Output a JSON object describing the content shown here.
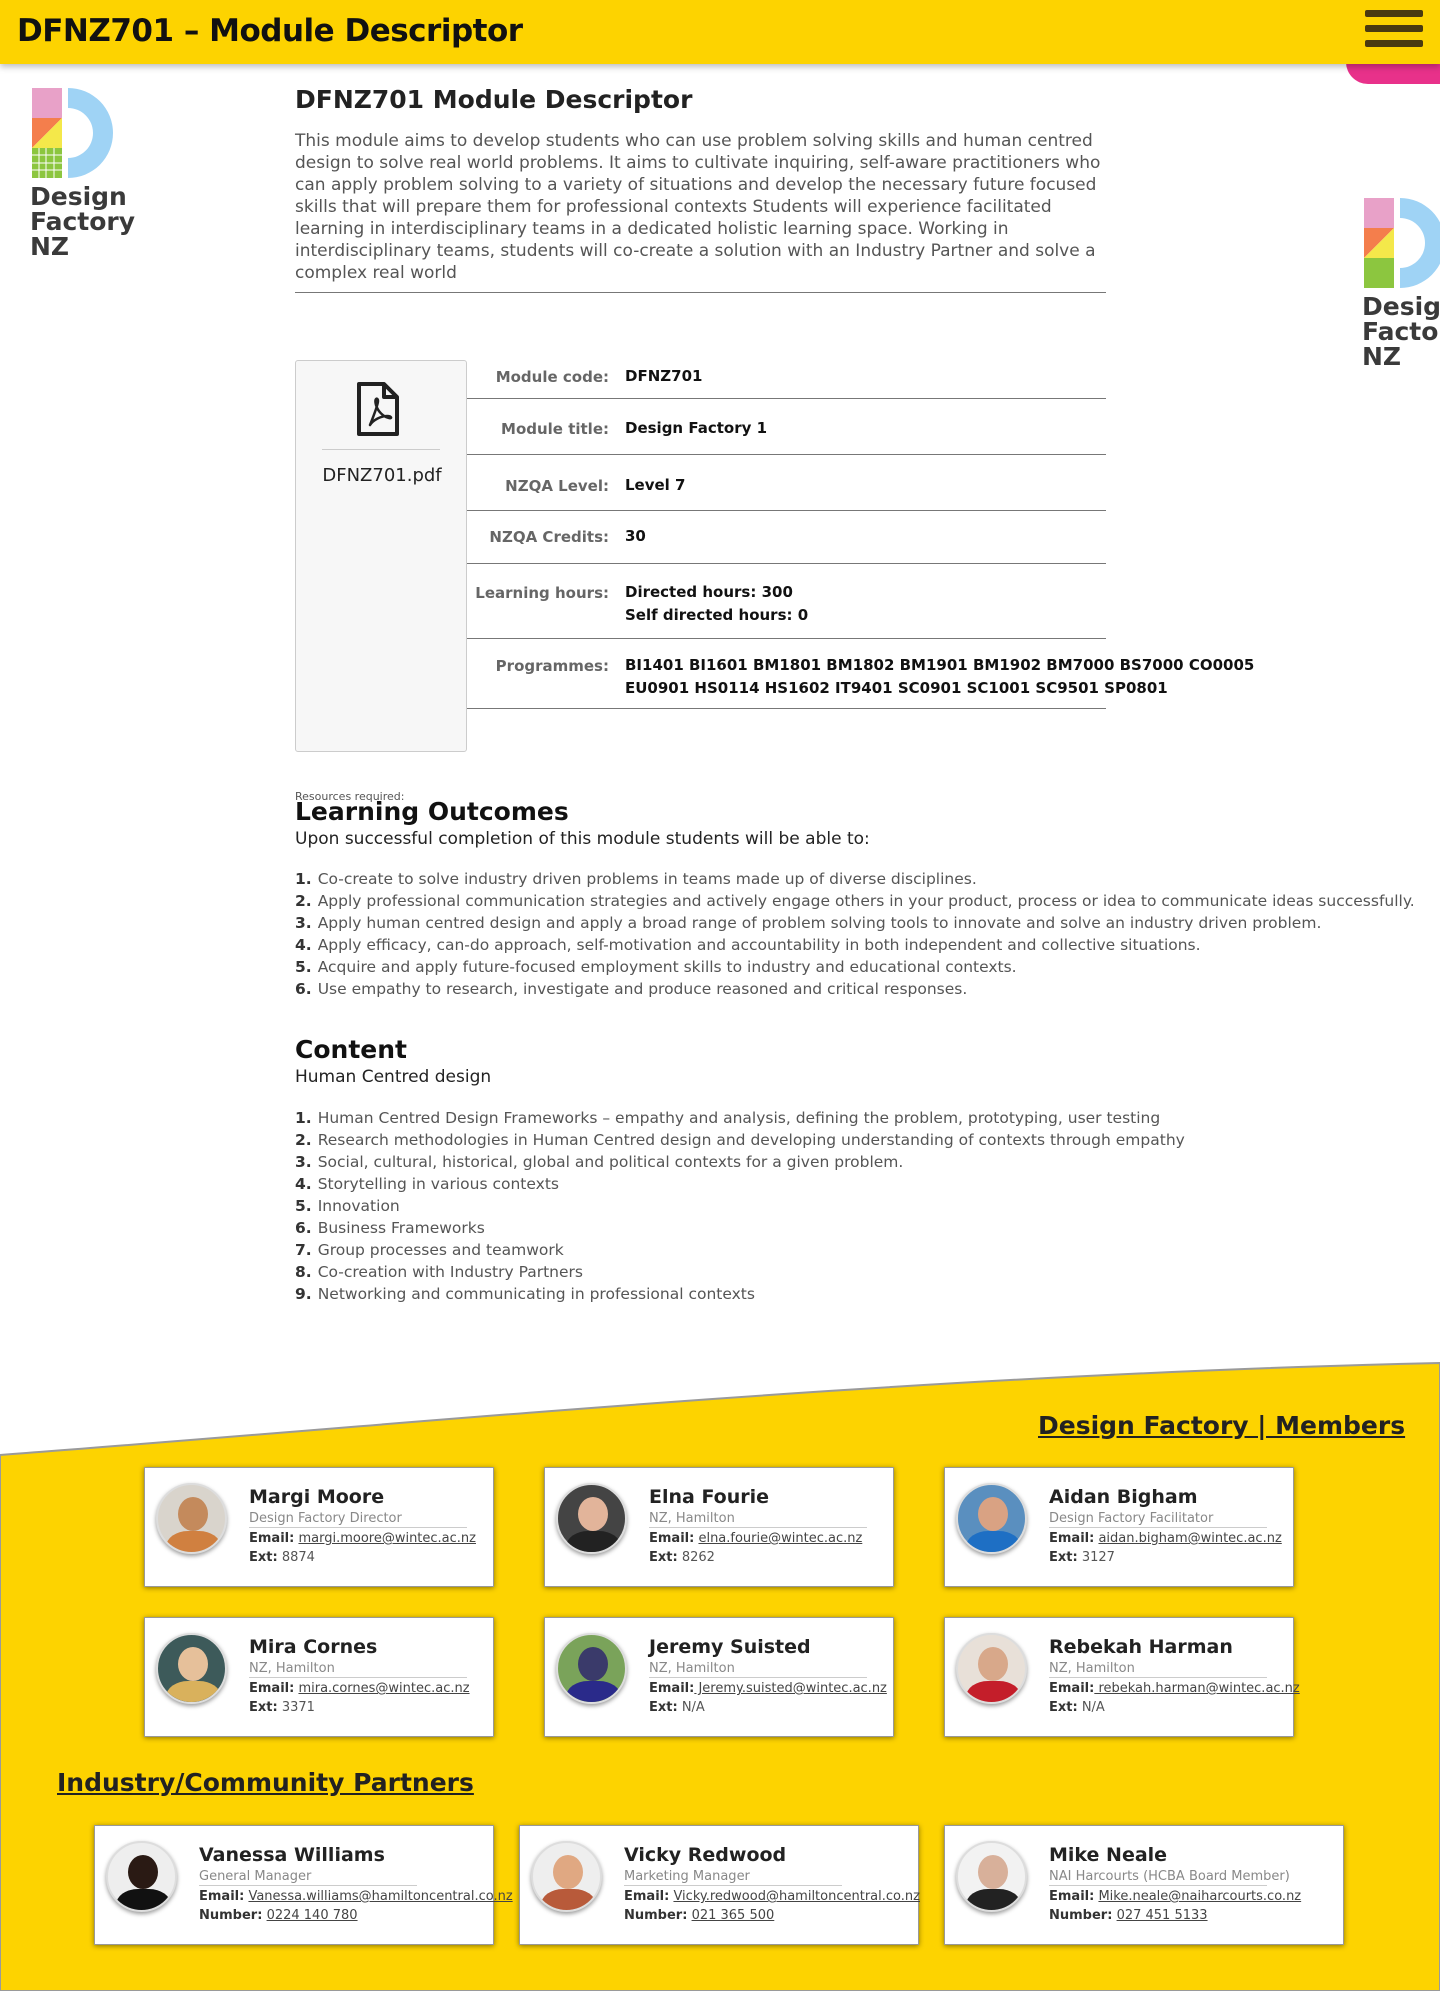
{
  "header": {
    "title": "DFNZ701 – Module Descriptor",
    "menu_icon": "hamburger-menu-icon"
  },
  "logo": {
    "text": "Design\nFactory\nNZ",
    "colors": {
      "pink": "#e8a1c8",
      "orange": "#f47e4c",
      "yellow": "#f4e84a",
      "green": "#8cc63f",
      "blue": "#9fd3f5"
    }
  },
  "module": {
    "title": "DFNZ701 Module Descriptor",
    "intro": "This module aims to develop students who can use problem solving skills and human centred design to solve real world problems. It aims to cultivate inquiring, self-aware practitioners who can apply problem solving to a variety of situations and develop the necessary future focused skills that will prepare them for professional contexts Students will experience facilitated learning in interdisciplinary teams in a dedicated holistic learning space. Working in interdisciplinary teams, students will co-create a solution with an Industry Partner and solve a complex real world",
    "pdf_name": "DFNZ701.pdf",
    "details": [
      {
        "label": "Module code:",
        "value": "DFNZ701"
      },
      {
        "label": "Module title:",
        "value": "Design Factory 1"
      },
      {
        "label": "NZQA Level:",
        "value": "Level 7"
      },
      {
        "label": "NZQA Credits:",
        "value": "30"
      },
      {
        "label": "Learning hours:",
        "value": "Directed hours: 300",
        "value2": "Self directed hours: 0"
      },
      {
        "label": "Programmes:",
        "value": "BI1401 BI1601 BM1801 BM1802 BM1901 BM1902 BM7000 BS7000 CO0005",
        "value2": "EU0901 HS0114 HS1602 IT9401 SC0901 SC1001 SC9501 SP0801"
      }
    ],
    "resources_label": "Resources required:"
  },
  "outcomes": {
    "title": "Learning Outcomes",
    "intro": "Upon successful completion of this module students will be able to:",
    "items": [
      {
        "num": "1.",
        "text": "Co-create to solve industry driven problems in teams made up of diverse disciplines."
      },
      {
        "num": "2.",
        "text": "Apply professional communication strategies and actively engage others in your product, process or idea to communicate ideas successfully."
      },
      {
        "num": "3.",
        "text": "Apply human centred design and apply a broad range of problem solving tools to innovate and solve an industry driven problem."
      },
      {
        "num": "4.",
        "text": "Apply efficacy, can-do approach, self-motivation and accountability in both independent and collective situations."
      },
      {
        "num": "5.",
        "text": "Acquire and apply future-focused employment skills to industry and educational contexts."
      },
      {
        "num": "6.",
        "text": "Use empathy to research, investigate and produce reasoned and critical responses."
      }
    ]
  },
  "content": {
    "title": "Content",
    "intro": "Human Centred design",
    "items": [
      {
        "num": "1.",
        "text": "Human Centred Design Frameworks – empathy and analysis, defining the problem, prototyping, user testing"
      },
      {
        "num": "2.",
        "text": "Research methodologies in Human Centred design and developing understanding of contexts through empathy"
      },
      {
        "num": "3.",
        "text": "Social, cultural, historical, global and political contexts for a given problem."
      },
      {
        "num": "4.",
        "text": "Storytelling in various contexts"
      },
      {
        "num": "5.",
        "text": "Innovation"
      },
      {
        "num": "6.",
        "text": "Business Frameworks"
      },
      {
        "num": "7.",
        "text": "Group processes and teamwork"
      },
      {
        "num": "8.",
        "text": "Co-creation with Industry Partners"
      },
      {
        "num": "9.",
        "text": "Networking and communicating in professional contexts"
      }
    ]
  },
  "members": {
    "title": "Design Factory | Members",
    "people": [
      {
        "name": "Margi Moore",
        "role": "Design Factory Director",
        "email_label": "Email:",
        "email": "margi.moore@wintec.ac.nz",
        "ext_label": "Ext:",
        "ext": "8874"
      },
      {
        "name": "Elna Fourie",
        "role": "NZ, Hamilton",
        "email_label": "Email:",
        "email": "elna.fourie@wintec.ac.nz",
        "ext_label": "Ext:",
        "ext": "8262"
      },
      {
        "name": "Aidan Bigham",
        "role": "Design Factory Facilitator",
        "email_label": "Email:",
        "email": "aidan.bigham@wintec.ac.nz",
        "ext_label": "Ext:",
        "ext": "3127"
      },
      {
        "name": "Mira Cornes",
        "role": "NZ, Hamilton",
        "email_label": "Email:",
        "email": "mira.cornes@wintec.ac.nz",
        "ext_label": "Ext:",
        "ext": "3371"
      },
      {
        "name": "Jeremy Suisted",
        "role": "NZ, Hamilton",
        "email_label": "Email:",
        "email": " Jeremy.suisted@wintec.ac.nz",
        "ext_label": "Ext:",
        "ext": "N/A"
      },
      {
        "name": "Rebekah Harman",
        "role": "NZ, Hamilton",
        "email_label": "Email:",
        "email": " rebekah.harman@wintec.ac.nz",
        "ext_label": "Ext:",
        "ext": "N/A"
      }
    ]
  },
  "partners": {
    "title": "Industry/Community Partners",
    "people": [
      {
        "name": "Vanessa Williams",
        "role": "General Manager",
        "email_label": "Email:",
        "email": "Vanessa.williams@hamiltoncentral.co.nz",
        "num_label": "Number:",
        "number": "0224 140 780"
      },
      {
        "name": "Vicky Redwood",
        "role": "Marketing Manager",
        "email_label": "Email:",
        "email": "Vicky.redwood@hamiltoncentral.co.nz",
        "num_label": "Number:",
        "number": "021 365 500"
      },
      {
        "name": "Mike Neale",
        "role": "NAI Harcourts (HCBA Board Member)",
        "email_label": "Email:",
        "email": "Mike.neale@naiharcourts.co.nz",
        "num_label": "Number:",
        "number": "027 451 5133"
      }
    ]
  },
  "colors": {
    "brand_yellow": "#fdd300",
    "accent_pink": "#e8318a"
  }
}
